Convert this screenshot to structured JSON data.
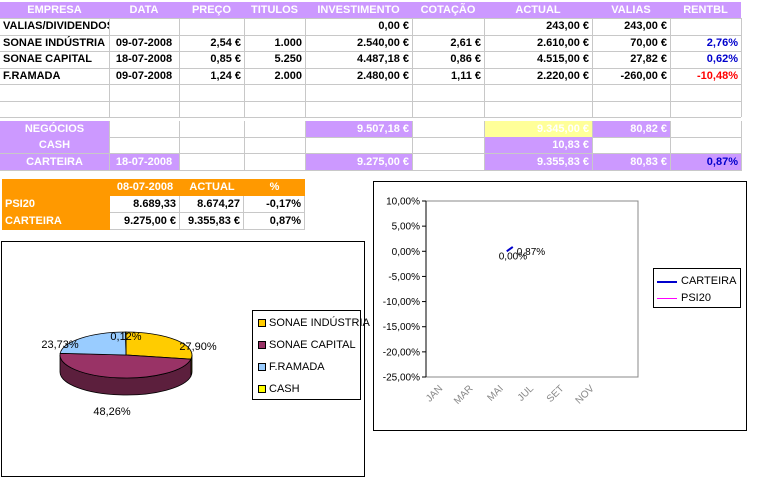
{
  "table": {
    "headers": [
      "EMPRESA",
      "DATA",
      "PREÇO",
      "TITULOS",
      "INVESTIMENTO",
      "COTAÇÃO",
      "ACTUAL",
      "VALIAS",
      "RENTBL"
    ],
    "rows": [
      [
        "VALIAS/DIVIDENDOS",
        "",
        "",
        "",
        "0,00 €",
        "",
        "243,00 €",
        "243,00 €",
        ""
      ],
      [
        "SONAE INDÚSTRIA",
        "09-07-2008",
        "2,54 €",
        "1.000",
        "2.540,00 €",
        "2,61 €",
        "2.610,00 €",
        "70,00 €",
        "2,76%"
      ],
      [
        "SONAE CAPITAL",
        "18-07-2008",
        "0,85 €",
        "5.250",
        "4.487,18 €",
        "0,86 €",
        "4.515,00 €",
        "27,82 €",
        "0,62%"
      ],
      [
        "F.RAMADA",
        "09-07-2008",
        "1,24 €",
        "2.000",
        "2.480,00 €",
        "1,11 €",
        "2.220,00 €",
        "-260,00 €",
        "-10,48%"
      ]
    ],
    "summary": {
      "negocios": {
        "label": "NEGÓCIOS",
        "investimento": "9.507,18 €",
        "actual": "9.345,00 €",
        "valias": "80,82 €"
      },
      "cash": {
        "label": "CASH",
        "actual": "10,83 €"
      },
      "carteira": {
        "label": "CARTEIRA",
        "data": "18-07-2008",
        "investimento": "9.275,00 €",
        "actual": "9.355,83 €",
        "valias": "80,83 €",
        "rentbl": "0,87%"
      }
    }
  },
  "psi_table": {
    "headers": [
      "",
      "08-07-2008",
      "ACTUAL",
      "%"
    ],
    "rows": [
      [
        "PSI20",
        "8.689,33",
        "8.674,27",
        "-0,17%"
      ],
      [
        "CARTEIRA",
        "9.275,00 €",
        "9.355,83 €",
        "0,87%"
      ]
    ]
  },
  "colors": {
    "header": "#cc99ff",
    "orange": "#ff9900",
    "yellow": "#ffff99",
    "positive": "#0000cc",
    "negative": "#ff0000"
  },
  "chart_data": [
    {
      "type": "pie",
      "categories": [
        "SONAE INDÚSTRIA",
        "SONAE CAPITAL",
        "F.RAMADA",
        "CASH"
      ],
      "values": [
        27.9,
        48.26,
        23.73,
        0.12
      ],
      "labels": [
        "27,90%",
        "48,26%",
        "23,73%",
        "0,12%"
      ],
      "colors": [
        "#ffcc00",
        "#993366",
        "#99ccff",
        "#ffff00"
      ],
      "legend": "right"
    },
    {
      "type": "line",
      "x": [
        "JAN",
        "MAR",
        "MAI",
        "JUL",
        "SET",
        "NOV"
      ],
      "yticks": [
        "10,00%",
        "5,00%",
        "0,00%",
        "-5,00%",
        "-10,00%",
        "-15,00%",
        "-20,00%",
        "-25,00%"
      ],
      "ylim": [
        -25,
        10
      ],
      "series": [
        {
          "name": "CARTEIRA",
          "color": "#0000cc",
          "points": [
            [
              6.2,
              0.0
            ],
            [
              6.6,
              0.87
            ]
          ],
          "labels": [
            "0,00%",
            "0,87%"
          ]
        },
        {
          "name": "PSI20",
          "color": "#ff00ff",
          "points": []
        }
      ],
      "legend": "right"
    }
  ]
}
